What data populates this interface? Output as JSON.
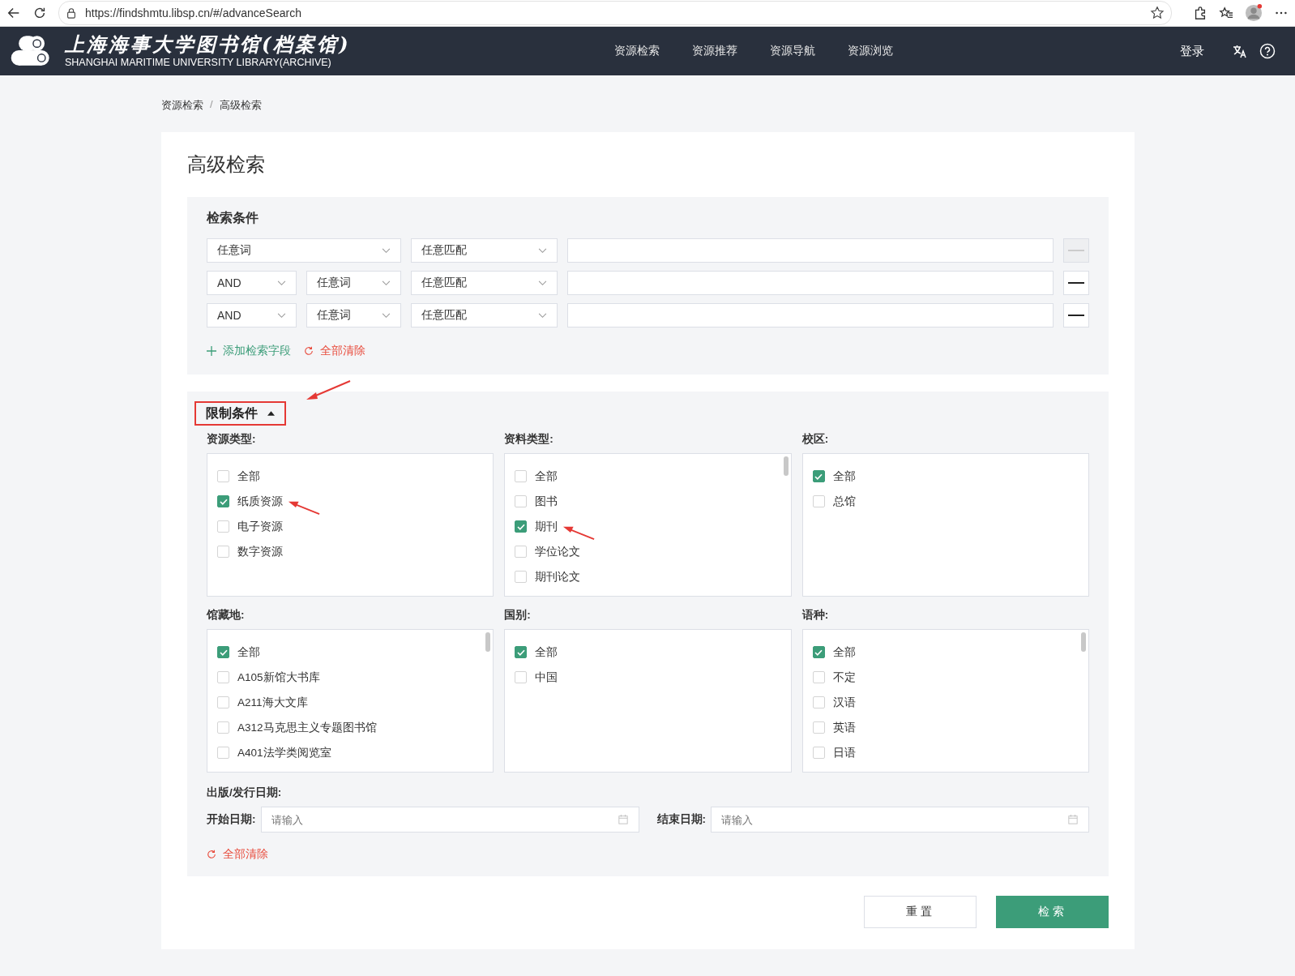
{
  "browser": {
    "url": "https://findshmtu.libsp.cn/#/advanceSearch"
  },
  "header": {
    "title": "上海海事大学图书馆(档案馆)",
    "subtitle": "SHANGHAI MARITIME UNIVERSITY LIBRARY(ARCHIVE)",
    "nav": [
      "资源检索",
      "资源推荐",
      "资源导航",
      "资源浏览"
    ],
    "login": "登录"
  },
  "breadcrumb": {
    "items": [
      "资源检索",
      "高级检索"
    ],
    "separator": "/"
  },
  "page_title": "高级检索",
  "search": {
    "heading": "检索条件",
    "rows": [
      {
        "field": "任意词",
        "match": "任意匹配",
        "value": "",
        "remove_disabled": true
      },
      {
        "operator": "AND",
        "field": "任意词",
        "match": "任意匹配",
        "value": "",
        "remove_disabled": false
      },
      {
        "operator": "AND",
        "field": "任意词",
        "match": "任意匹配",
        "value": "",
        "remove_disabled": false
      }
    ],
    "add_field": "添加检索字段",
    "clear_all": "全部清除"
  },
  "filters": {
    "heading": "限制条件",
    "highlighted": true,
    "expanded": true,
    "groups": [
      {
        "label": "资源类型:",
        "options": [
          {
            "label": "全部",
            "checked": false,
            "annotated": false
          },
          {
            "label": "纸质资源",
            "checked": true,
            "annotated": true
          },
          {
            "label": "电子资源",
            "checked": false,
            "annotated": false
          },
          {
            "label": "数字资源",
            "checked": false,
            "annotated": false
          }
        ],
        "more_below": false
      },
      {
        "label": "资料类型:",
        "options": [
          {
            "label": "全部",
            "checked": false,
            "annotated": false
          },
          {
            "label": "图书",
            "checked": false,
            "annotated": false
          },
          {
            "label": "期刊",
            "checked": true,
            "annotated": true
          },
          {
            "label": "学位论文",
            "checked": false,
            "annotated": false
          },
          {
            "label": "期刊论文",
            "checked": false,
            "annotated": false
          }
        ],
        "more_below": true
      },
      {
        "label": "校区:",
        "options": [
          {
            "label": "全部",
            "checked": true,
            "annotated": false
          },
          {
            "label": "总馆",
            "checked": false,
            "annotated": false
          }
        ],
        "more_below": false
      },
      {
        "label": "馆藏地:",
        "options": [
          {
            "label": "全部",
            "checked": true,
            "annotated": false
          },
          {
            "label": "A105新馆大书库",
            "checked": false,
            "annotated": false
          },
          {
            "label": "A211海大文库",
            "checked": false,
            "annotated": false
          },
          {
            "label": "A312马克思主义专题图书馆",
            "checked": false,
            "annotated": false
          },
          {
            "label": "A401法学类阅览室",
            "checked": false,
            "annotated": false
          }
        ],
        "more_below": true
      },
      {
        "label": "国别:",
        "options": [
          {
            "label": "全部",
            "checked": true,
            "annotated": false
          },
          {
            "label": "中国",
            "checked": false,
            "annotated": false
          }
        ],
        "more_below": false
      },
      {
        "label": "语种:",
        "options": [
          {
            "label": "全部",
            "checked": true,
            "annotated": false
          },
          {
            "label": "不定",
            "checked": false,
            "annotated": false
          },
          {
            "label": "汉语",
            "checked": false,
            "annotated": false
          },
          {
            "label": "英语",
            "checked": false,
            "annotated": false
          },
          {
            "label": "日语",
            "checked": false,
            "annotated": false
          }
        ],
        "more_below": true
      }
    ],
    "date": {
      "heading": "出版/发行日期:",
      "start_label": "开始日期:",
      "start_placeholder": "请输入",
      "end_label": "结束日期:",
      "end_placeholder": "请输入"
    },
    "clear_all": "全部清除"
  },
  "buttons": {
    "reset": "重置",
    "search": "检索"
  }
}
